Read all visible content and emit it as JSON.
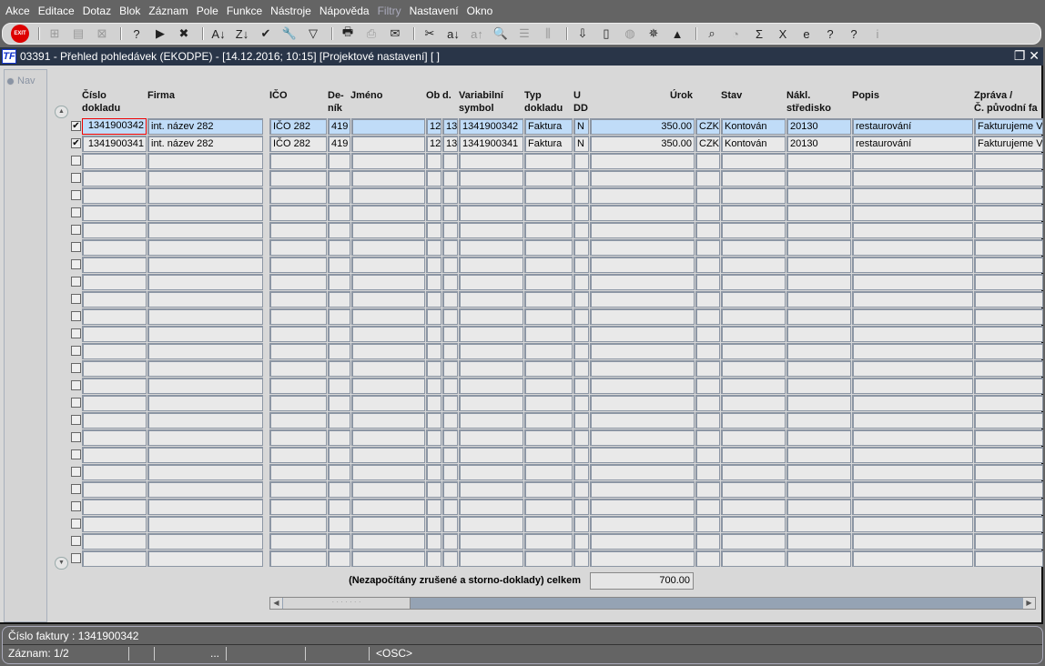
{
  "menu": [
    "Akce",
    "Editace",
    "Dotaz",
    "Blok",
    "Záznam",
    "Pole",
    "Funkce",
    "Nástroje",
    "Nápověda",
    "Filtry",
    "Nastavení",
    "Okno"
  ],
  "toolbar": {
    "exit_label": "EXIT",
    "icons": [
      {
        "name": "exit-icon",
        "g": "EXIT"
      },
      {
        "sep": true
      },
      {
        "name": "insert-record-icon",
        "g": "⊞",
        "dis": true
      },
      {
        "name": "duplicate-record-icon",
        "g": "▤",
        "dis": true
      },
      {
        "name": "delete-record-icon",
        "g": "⊠",
        "dis": true
      },
      {
        "sep": true
      },
      {
        "name": "query-enter-icon",
        "g": "?"
      },
      {
        "name": "query-execute-icon",
        "g": "▶"
      },
      {
        "name": "query-cancel-icon",
        "g": "✖"
      },
      {
        "sep": true
      },
      {
        "name": "sort-asc-icon",
        "g": "A↓"
      },
      {
        "name": "sort-desc-icon",
        "g": "Z↓"
      },
      {
        "name": "check-icon",
        "g": "✔"
      },
      {
        "name": "wrench-icon",
        "g": "🔧"
      },
      {
        "name": "filter-icon",
        "g": "▽"
      },
      {
        "sep": true
      },
      {
        "name": "print-icon",
        "g": "🖶"
      },
      {
        "name": "print-setup-icon",
        "g": "⎙",
        "dis": true
      },
      {
        "name": "email-icon",
        "g": "✉"
      },
      {
        "sep": true
      },
      {
        "name": "cut-icon",
        "g": "✂"
      },
      {
        "name": "translate-icon",
        "g": "a↓"
      },
      {
        "name": "translate-alt-icon",
        "g": "a↑",
        "dis": true
      },
      {
        "name": "zoom-icon",
        "g": "🔍"
      },
      {
        "name": "list-icon",
        "g": "☰",
        "dis": true
      },
      {
        "name": "columns-icon",
        "g": "⫼",
        "dis": true
      },
      {
        "sep": true
      },
      {
        "name": "import-icon",
        "g": "⇩"
      },
      {
        "name": "document-icon",
        "g": "▯"
      },
      {
        "name": "globe-icon",
        "g": "◍",
        "dis": true
      },
      {
        "name": "wheel-icon",
        "g": "✵"
      },
      {
        "name": "alert-icon",
        "g": "▲"
      },
      {
        "sep": true
      },
      {
        "name": "preview-icon",
        "g": "⌕"
      },
      {
        "name": "percent-icon",
        "g": "◔",
        "dis": true
      },
      {
        "name": "sum-icon",
        "g": "Σ"
      },
      {
        "name": "excel-icon",
        "g": "X"
      },
      {
        "name": "browser-icon",
        "g": "e"
      },
      {
        "name": "help-icon",
        "g": "?"
      },
      {
        "name": "help-window-icon",
        "g": "?"
      },
      {
        "name": "info-icon",
        "g": "i",
        "dis": true
      }
    ]
  },
  "window": {
    "title": "03391 - Přehled pohledávek (EKODPE) - [14.12.2016; 10:15]  [Projektové nastavení]  [ ]",
    "logo": "TF"
  },
  "nav": "Nav",
  "columns": [
    {
      "key": "cislo",
      "label": [
        "Číslo",
        "dokladu"
      ]
    },
    {
      "key": "firma",
      "label": [
        "",
        "Firma"
      ]
    },
    {
      "key": "ico",
      "label": [
        "",
        "IČO"
      ]
    },
    {
      "key": "denik",
      "label": [
        "De-",
        "ník"
      ]
    },
    {
      "key": "jmeno",
      "label": [
        "",
        "Jméno"
      ]
    },
    {
      "key": "ob",
      "label": [
        "",
        "Ob"
      ]
    },
    {
      "key": "d",
      "label": [
        "",
        "d."
      ]
    },
    {
      "key": "vs",
      "label": [
        "Variabilní",
        "symbol"
      ]
    },
    {
      "key": "typ",
      "label": [
        "Typ",
        "dokladu"
      ]
    },
    {
      "key": "udd",
      "label": [
        "U",
        "DD"
      ]
    },
    {
      "key": "urok",
      "label": [
        "",
        "Úrok"
      ]
    },
    {
      "key": "mena",
      "label": [
        "",
        ""
      ]
    },
    {
      "key": "stav",
      "label": [
        "",
        "Stav"
      ]
    },
    {
      "key": "nakl",
      "label": [
        "Nákl.",
        "středisko"
      ]
    },
    {
      "key": "popis",
      "label": [
        "",
        "Popis"
      ]
    },
    {
      "key": "zprava",
      "label": [
        "Zpráva /",
        "Č. původní fa"
      ]
    }
  ],
  "rows": [
    {
      "checked": true,
      "cislo": "1341900342",
      "firma": "int. název 282",
      "ico": "IČO 282",
      "denik": "419",
      "jmeno": "",
      "ob": "12",
      "d": "13",
      "vs": "1341900342",
      "typ": "Faktura",
      "udd": "N",
      "urok": "350.00",
      "mena": "CZK",
      "stav": "Kontován",
      "nakl": "20130",
      "popis": "restaurování",
      "zprava": "Fakturujeme V"
    },
    {
      "checked": true,
      "cislo": "1341900341",
      "firma": "int. název 282",
      "ico": "IČO 282",
      "denik": "419",
      "jmeno": "",
      "ob": "12",
      "d": "13",
      "vs": "1341900341",
      "typ": "Faktura",
      "udd": "N",
      "urok": "350.00",
      "mena": "CZK",
      "stav": "Kontován",
      "nakl": "20130",
      "popis": "restaurování",
      "zprava": "Fakturujeme V"
    }
  ],
  "empty_rows": 24,
  "total": {
    "label": "(Nezapočítány zrušené a storno-doklady) celkem",
    "value": "700.00"
  },
  "status": {
    "line1": "Číslo faktury : 1341900342",
    "record": "Záznam: 1/2",
    "ellipsis": "...",
    "mode": "<OSC>"
  }
}
